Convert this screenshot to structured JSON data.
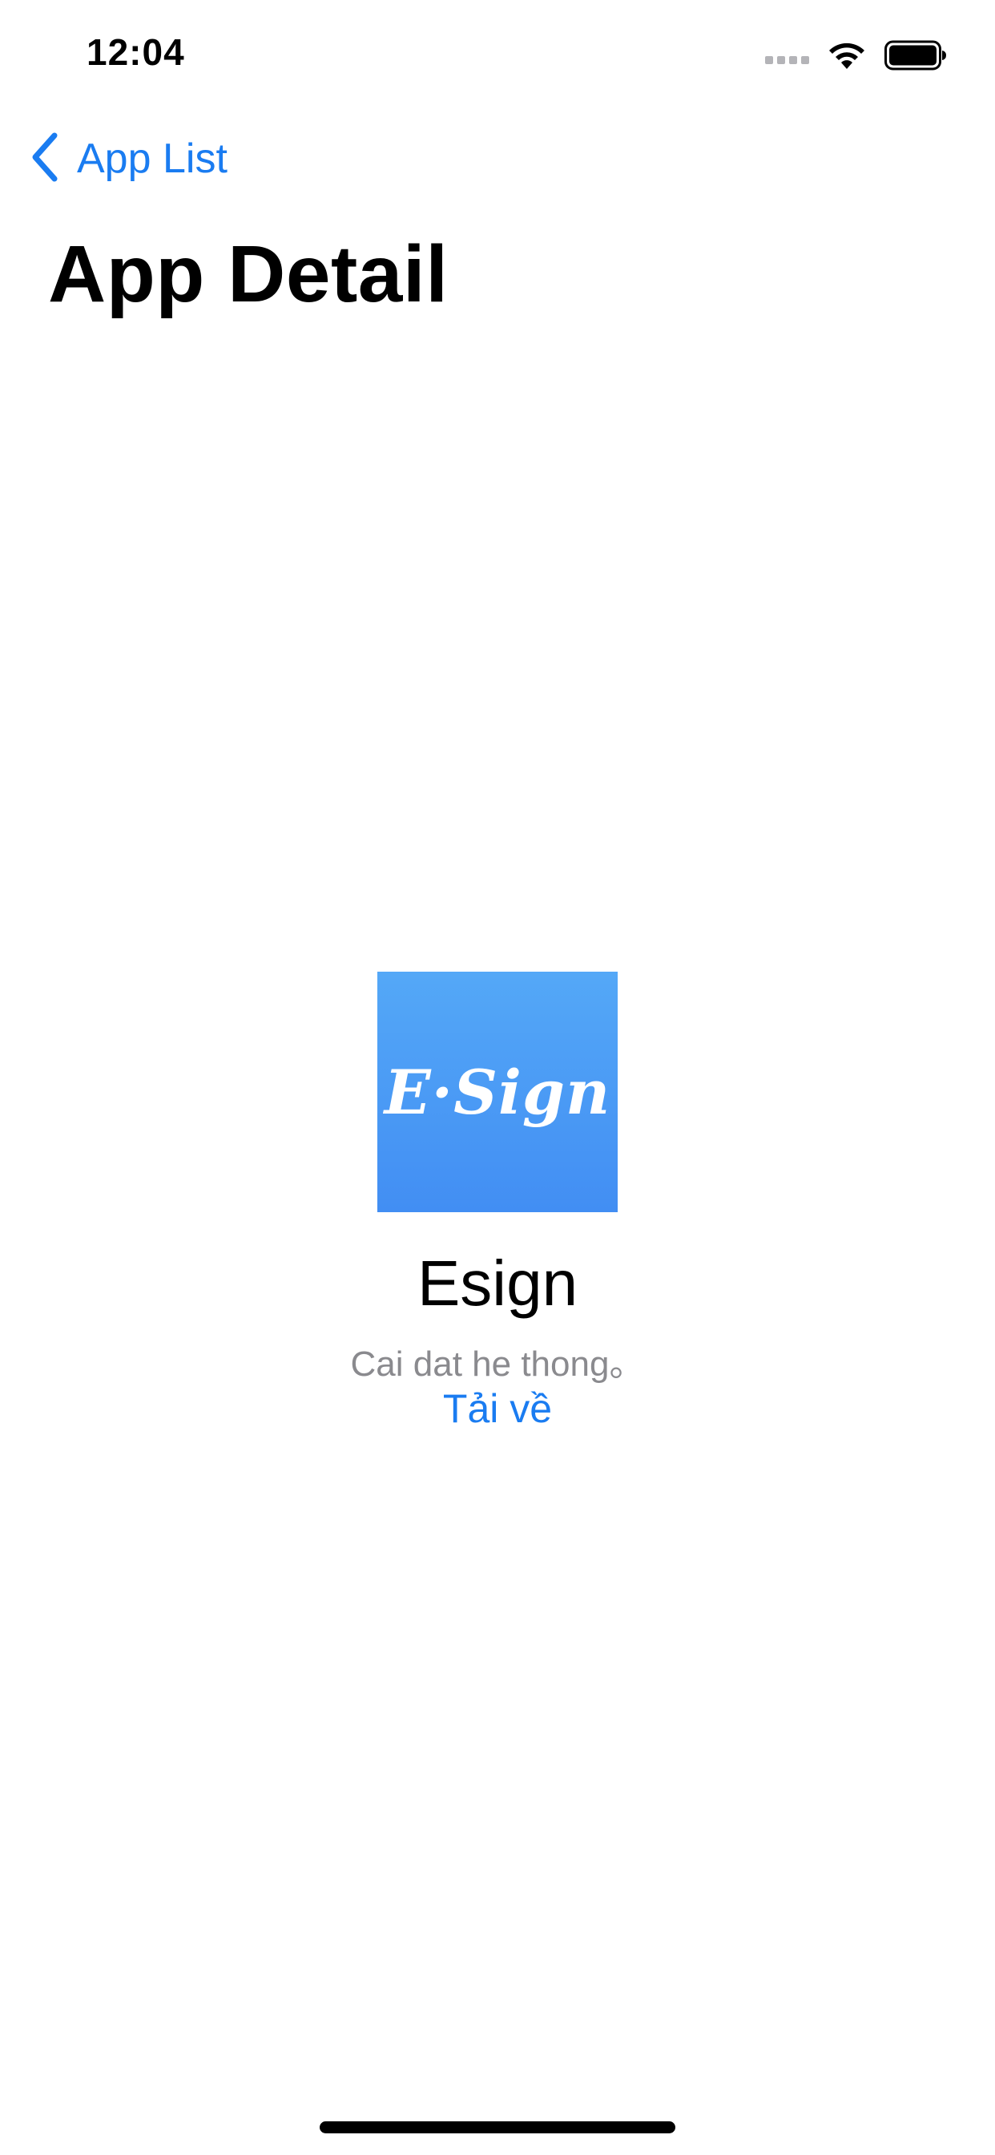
{
  "status_bar": {
    "time": "12:04",
    "icons": [
      "cellular-signal-icon",
      "wifi-icon",
      "battery-icon"
    ]
  },
  "navigation": {
    "back_label": "App List",
    "back_icon": "chevron-left-icon",
    "title": "App Detail"
  },
  "app": {
    "icon_logo_text": "E·Sign",
    "name": "Esign",
    "description": "Cai dat he thong。",
    "download_label": "Tải về"
  },
  "colors": {
    "accent": "#1a7cf1",
    "secondary_text": "#8a8a8e",
    "icon_gradient_top": "#54a8f7",
    "icon_gradient_bottom": "#428ef3"
  }
}
